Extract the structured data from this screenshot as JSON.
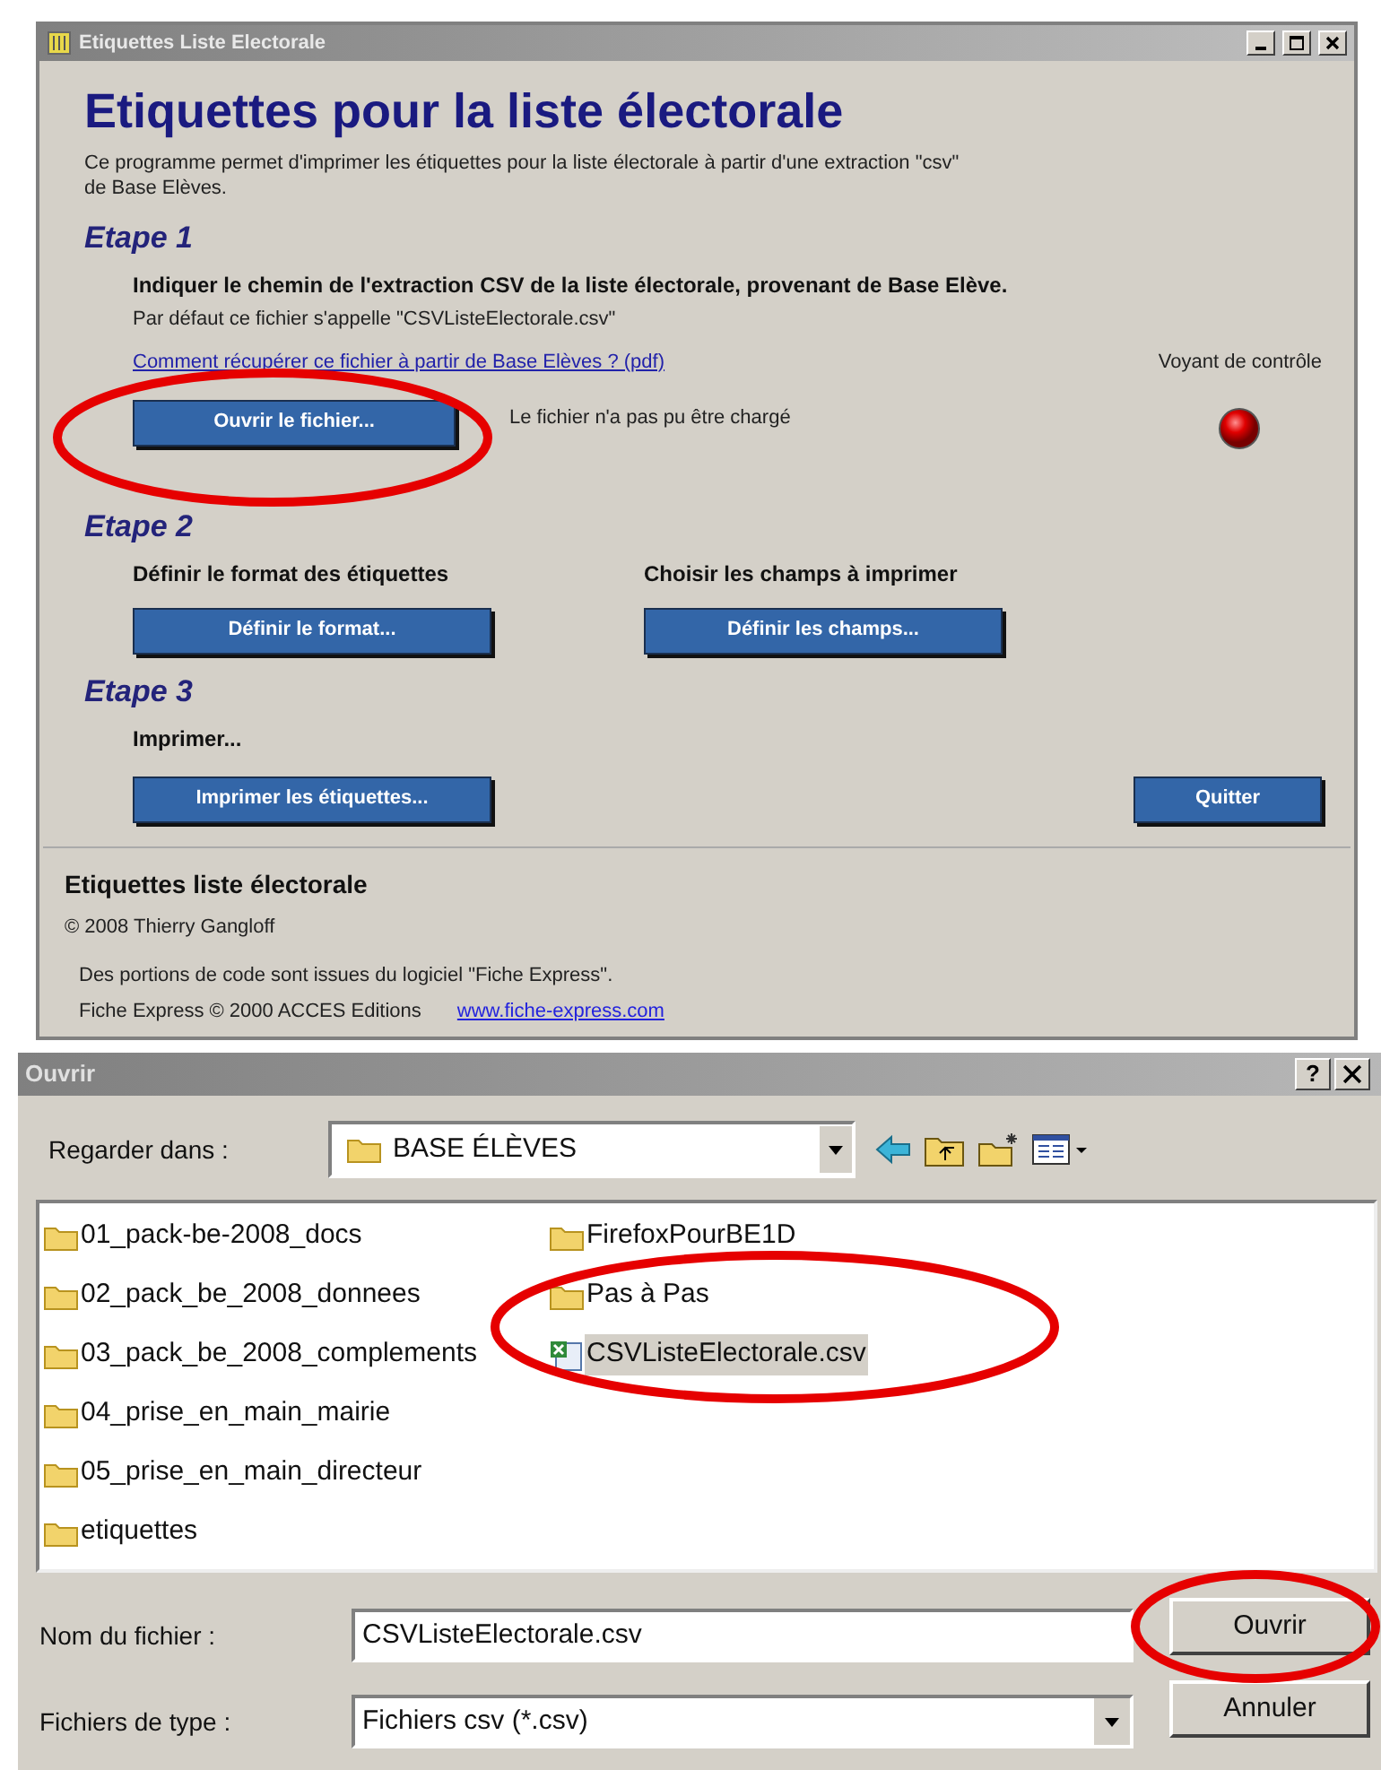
{
  "main_window": {
    "title": "Etiquettes Liste Electorale",
    "heading": "Etiquettes pour la liste électorale",
    "intro": "Ce programme permet d'imprimer les étiquettes pour la liste électorale à partir d'une extraction \"csv\" de Base Elèves.",
    "step1": {
      "title": "Etape 1",
      "instruction": "Indiquer le chemin de l'extraction CSV de la liste électorale, provenant de  Base Elève.",
      "note": "Par défaut ce fichier s'appelle \"CSVListeElectorale.csv\"",
      "link": "Comment récupérer ce fichier à partir de Base Elèves ? (pdf)",
      "button": "Ouvrir le fichier...",
      "status": "Le fichier n'a pas pu être chargé",
      "indicator_label": "Voyant de contrôle"
    },
    "step2": {
      "title": "Etape 2",
      "columns": [
        {
          "label": "Définir le format des étiquettes",
          "button": "Définir le format..."
        },
        {
          "label": "Choisir les champs à imprimer",
          "button": "Définir les champs..."
        }
      ]
    },
    "step3": {
      "title": "Etape 3",
      "label": "Imprimer...",
      "button": "Imprimer les étiquettes...",
      "quit_button": "Quitter"
    },
    "footer": {
      "title": "Etiquettes liste électorale",
      "copyright": "© 2008 Thierry Gangloff",
      "credit": "Des portions de code sont issues du logiciel \"Fiche Express\".",
      "credit2": "Fiche Express © 2000 ACCES Editions",
      "link": "www.fiche-express.com"
    }
  },
  "open_dialog": {
    "title": "Ouvrir",
    "help": "?",
    "look_in_label": "Regarder dans :",
    "look_in_value": "BASE ÉLÈVES",
    "files": [
      {
        "name": "01_pack-be-2008_docs",
        "kind": "folder",
        "selected": false
      },
      {
        "name": "02_pack_be_2008_donnees",
        "kind": "folder",
        "selected": false
      },
      {
        "name": "03_pack_be_2008_complements",
        "kind": "folder",
        "selected": false
      },
      {
        "name": "04_prise_en_main_mairie",
        "kind": "folder",
        "selected": false
      },
      {
        "name": "05_prise_en_main_directeur",
        "kind": "folder",
        "selected": false
      },
      {
        "name": "etiquettes",
        "kind": "folder",
        "selected": false
      },
      {
        "name": "FirefoxPourBE1D",
        "kind": "folder",
        "selected": false
      },
      {
        "name": "Pas à Pas",
        "kind": "folder",
        "selected": false
      },
      {
        "name": "CSVListeElectorale.csv",
        "kind": "csv",
        "selected": true
      }
    ],
    "filename_label": "Nom du fichier :",
    "filename_value": "CSVListeElectorale.csv",
    "filetype_label": "Fichiers de type :",
    "filetype_value": "Fichiers csv (*.csv)",
    "buttons": [
      "Ouvrir",
      "Annuler"
    ]
  }
}
